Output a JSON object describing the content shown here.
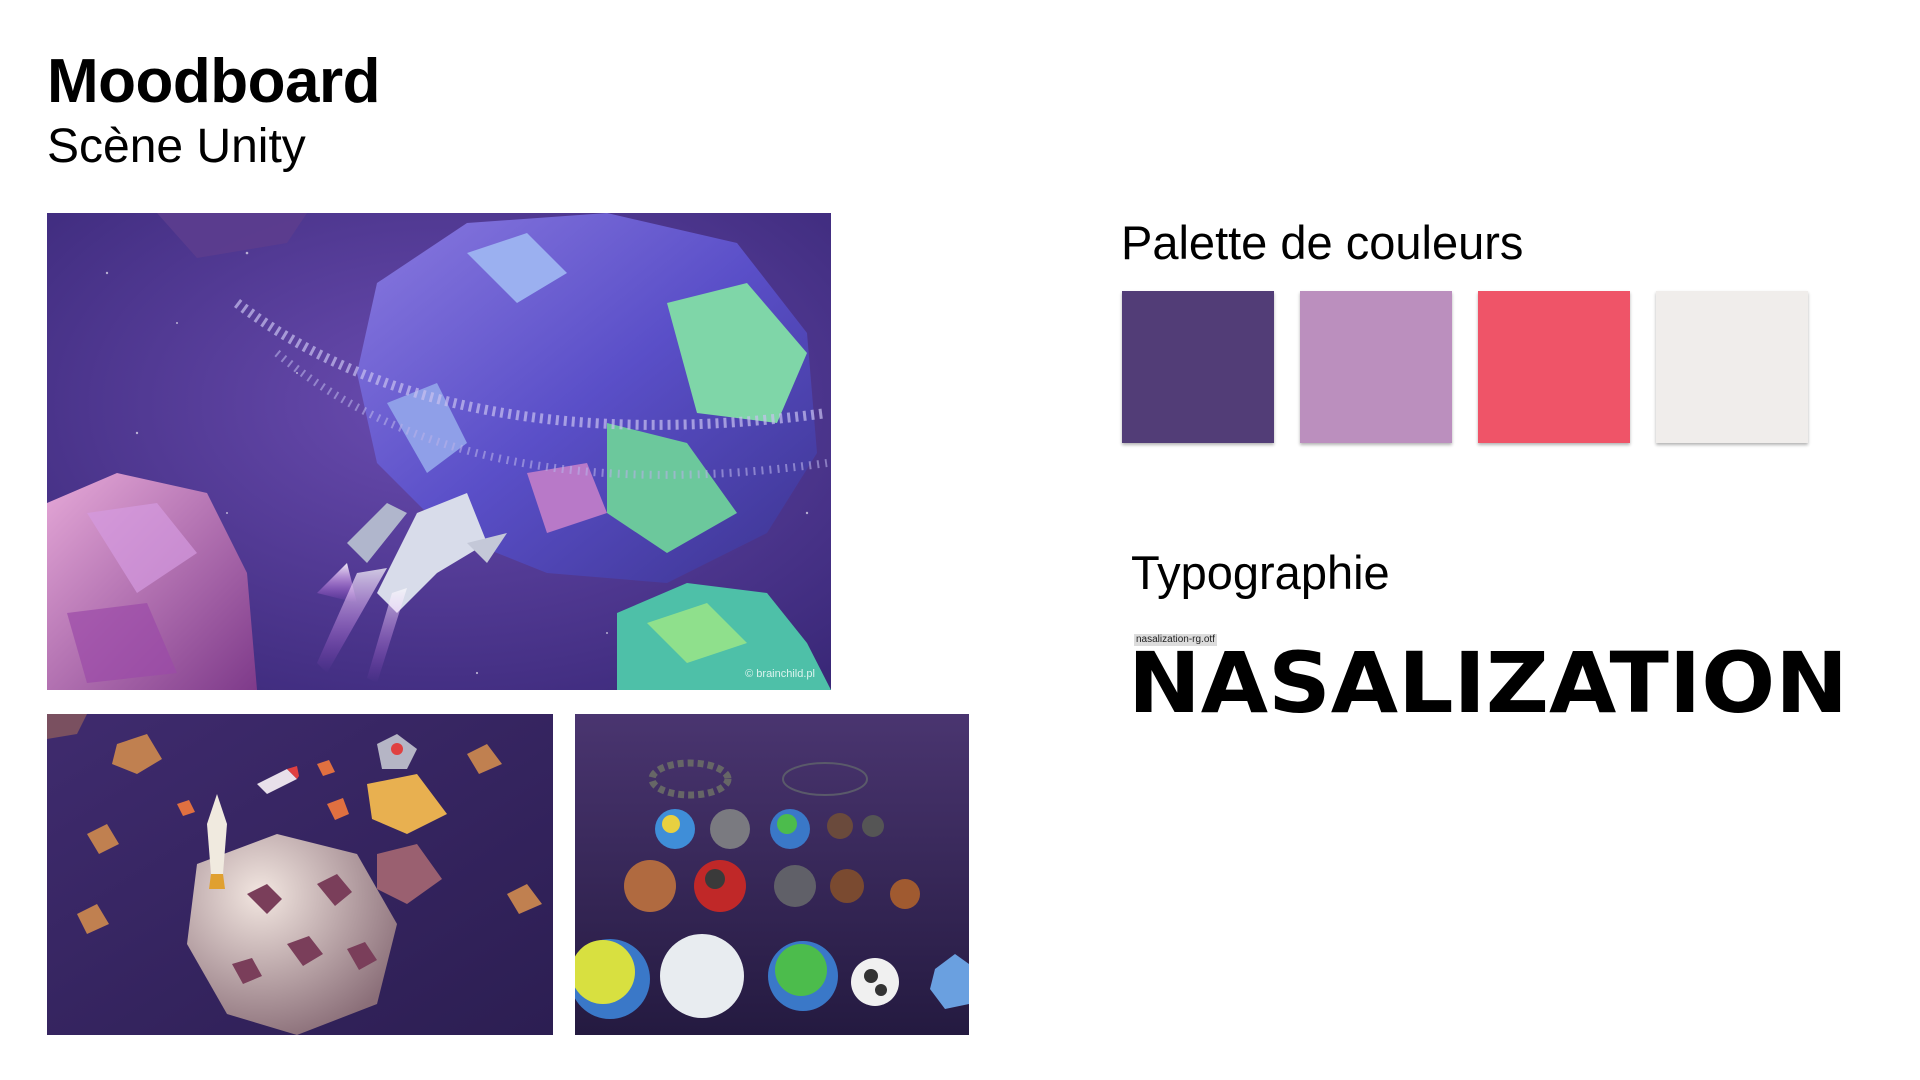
{
  "header": {
    "title": "Moodboard",
    "subtitle": "Scène Unity"
  },
  "images": {
    "main": {
      "credit": "© brainchild.pl"
    }
  },
  "palette": {
    "heading": "Palette de couleurs",
    "colors": [
      "#523D77",
      "#BB8FBE",
      "#EF5468",
      "#F0EDEB"
    ]
  },
  "typography": {
    "heading": "Typographie",
    "font_file": "nasalization-rg.otf",
    "sample": "NASALIZATION"
  }
}
